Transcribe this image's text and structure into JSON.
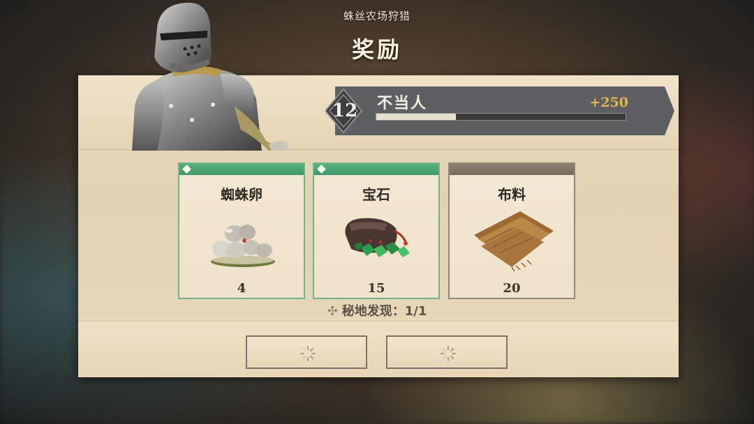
{
  "header": {
    "subtitle": "蛛丝农场狩猎",
    "title": "奖励"
  },
  "player": {
    "level": "12",
    "name": "不当人",
    "xp_gain": "+250",
    "xp_progress": 0.32
  },
  "rewards": [
    {
      "name": "蜘蛛卵",
      "count": "4",
      "rarity": "uncommon",
      "icon": "spider-eggs-icon"
    },
    {
      "name": "宝石",
      "count": "15",
      "rarity": "uncommon",
      "icon": "gem-bag-icon"
    },
    {
      "name": "布料",
      "count": "20",
      "rarity": "common",
      "icon": "cloth-icon"
    }
  ],
  "discovery": {
    "label": "秘地发现：1/1"
  },
  "colors": {
    "uncommon": "#4fa877",
    "common": "#857a6d",
    "xp_gain": "#e3b54e",
    "banner": "#5e5f62"
  },
  "buttons": [
    {
      "state": "loading",
      "icon": "loading-spinner-icon"
    },
    {
      "state": "loading",
      "icon": "loading-spinner-icon"
    }
  ]
}
